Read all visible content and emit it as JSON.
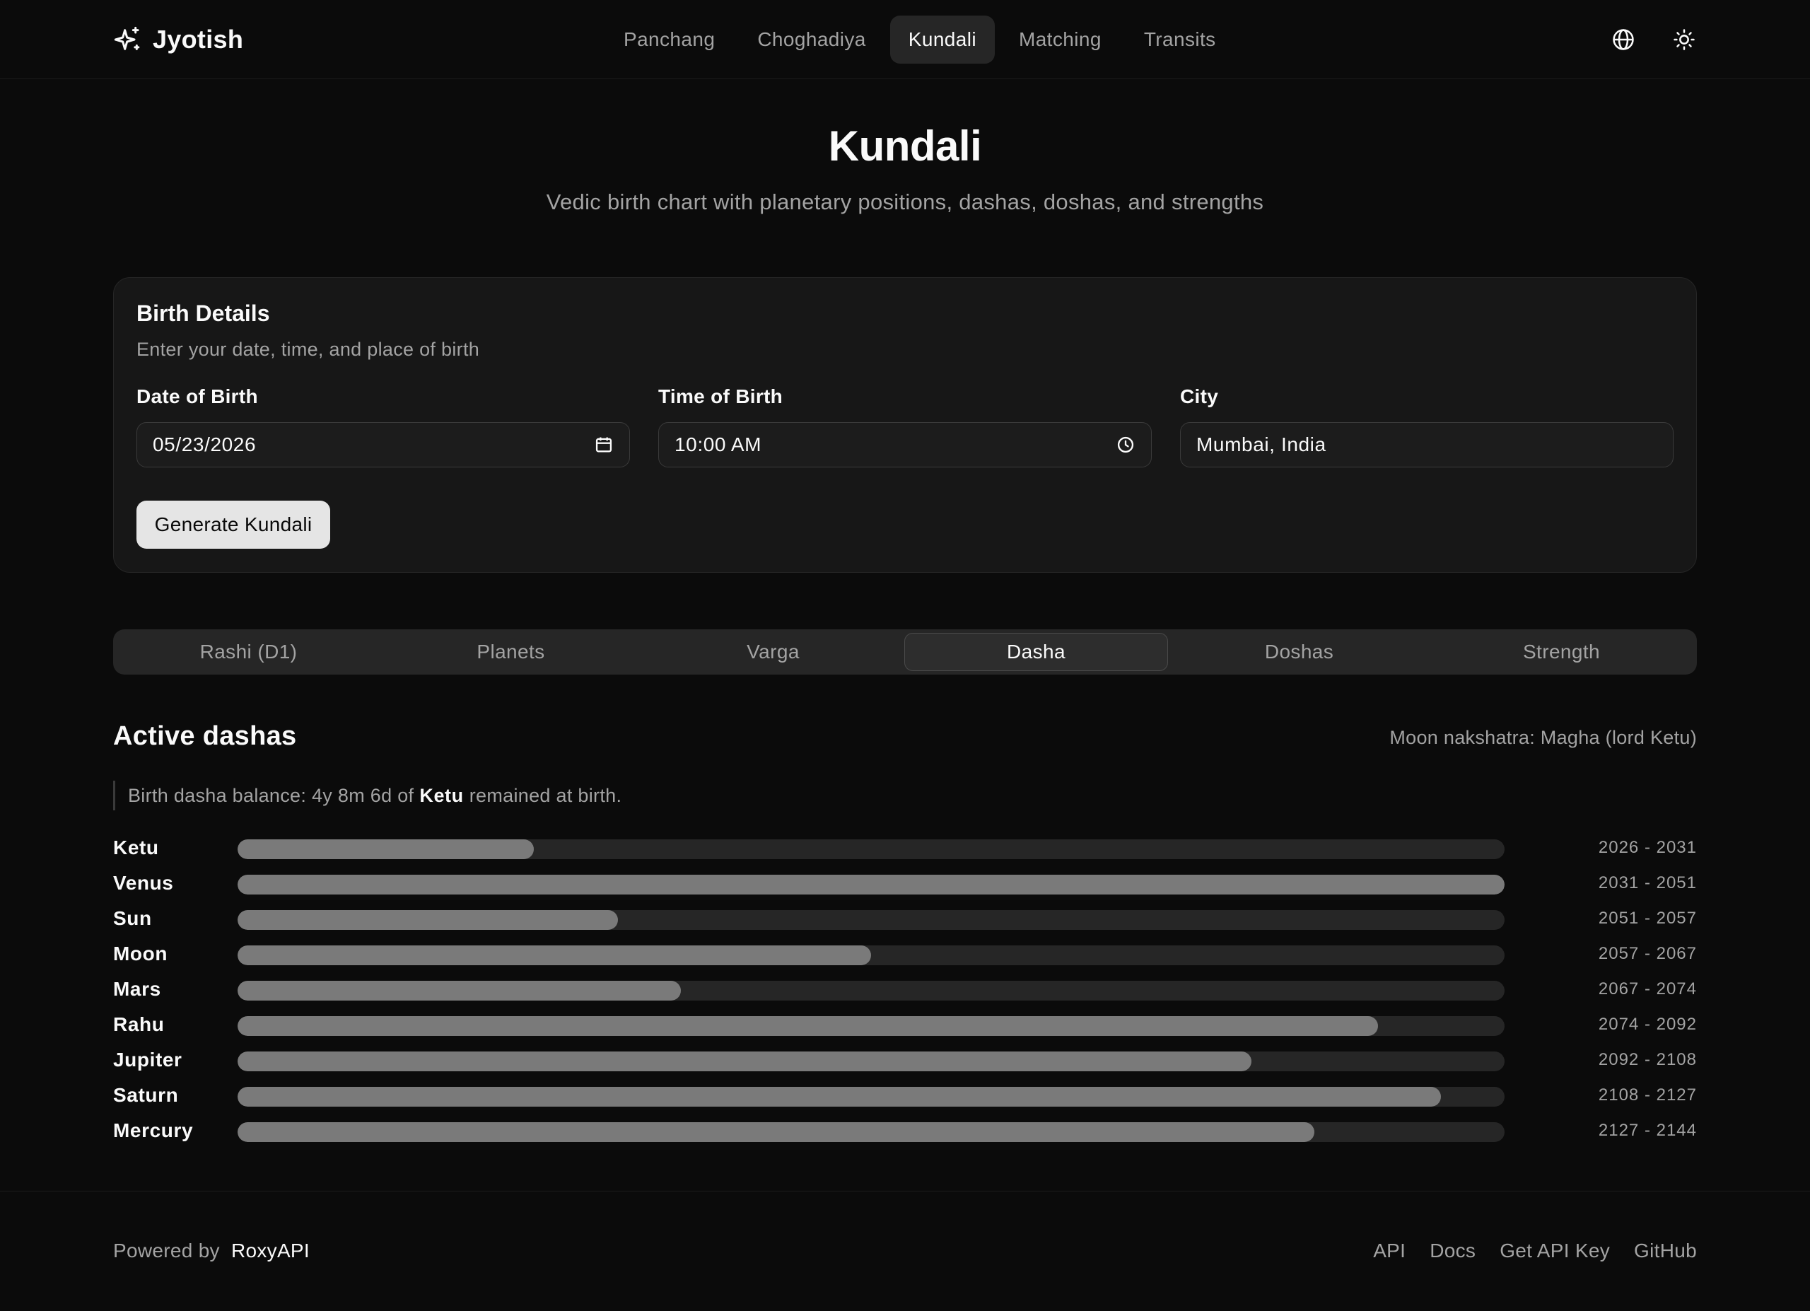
{
  "header": {
    "brand": "Jyotish",
    "brand_icon": "sparkles-icon",
    "nav": [
      {
        "label": "Panchang",
        "active": false
      },
      {
        "label": "Choghadiya",
        "active": false
      },
      {
        "label": "Kundali",
        "active": true
      },
      {
        "label": "Matching",
        "active": false
      },
      {
        "label": "Transits",
        "active": false
      }
    ],
    "icons": [
      "globe-icon",
      "sun-icon"
    ]
  },
  "hero": {
    "title": "Kundali",
    "subtitle": "Vedic birth chart with planetary positions, dashas, doshas, and strengths"
  },
  "birth_details": {
    "title": "Birth Details",
    "description": "Enter your date, time, and place of birth",
    "date": {
      "label": "Date of Birth",
      "value": "05/23/2026"
    },
    "time": {
      "label": "Time of Birth",
      "value": "10:00 AM"
    },
    "city": {
      "label": "City",
      "value": "Mumbai, India"
    },
    "submit_label": "Generate Kundali"
  },
  "tabs": [
    {
      "label": "Rashi (D1)",
      "active": false
    },
    {
      "label": "Planets",
      "active": false
    },
    {
      "label": "Varga",
      "active": false
    },
    {
      "label": "Dasha",
      "active": true
    },
    {
      "label": "Doshas",
      "active": false
    },
    {
      "label": "Strength",
      "active": false
    }
  ],
  "dasha": {
    "title": "Active dashas",
    "moon_nakshatra": "Moon nakshatra: Magha (lord Ketu)",
    "balance_prefix": "Birth dasha balance: 4y 8m 6d of",
    "balance_lord": "Ketu",
    "balance_suffix": "remained at birth.",
    "periods": [
      {
        "planet": "Ketu",
        "years": "2026 - 2031",
        "fill": 0.234
      },
      {
        "planet": "Venus",
        "years": "2031 - 2051",
        "fill": 1.0
      },
      {
        "planet": "Sun",
        "years": "2051 - 2057",
        "fill": 0.3
      },
      {
        "planet": "Moon",
        "years": "2057 - 2067",
        "fill": 0.5
      },
      {
        "planet": "Mars",
        "years": "2067 - 2074",
        "fill": 0.35
      },
      {
        "planet": "Rahu",
        "years": "2074 - 2092",
        "fill": 0.9
      },
      {
        "planet": "Jupiter",
        "years": "2092 - 2108",
        "fill": 0.8
      },
      {
        "planet": "Saturn",
        "years": "2108 - 2127",
        "fill": 0.95
      },
      {
        "planet": "Mercury",
        "years": "2127 - 2144",
        "fill": 0.85
      }
    ]
  },
  "footer": {
    "powered_by": "Powered by",
    "powered_brand": "RoxyAPI",
    "links": [
      "API",
      "Docs",
      "Get API Key",
      "GitHub"
    ]
  },
  "colors": {
    "background": "#0b0b0b",
    "card": "#171717",
    "bar_fill": "#7a7a7a",
    "bar_track": "#262626",
    "muted_text": "#a3a3a3"
  }
}
